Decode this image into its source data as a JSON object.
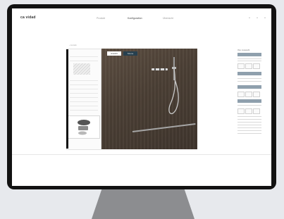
{
  "header": {
    "brand": "ca vidad",
    "tabs": [
      "Produkt",
      "Konfiguration",
      "Übersicht"
    ],
    "icons": [
      "search-icon",
      "user-icon",
      "cart-icon"
    ]
  },
  "breadcrumb": "‹ zurück",
  "canvas": {
    "buttons": [
      "Ansicht",
      "Szene"
    ]
  },
  "right_panel": {
    "title": "Ihre Auswahl"
  },
  "colors": {
    "monitor_bezel": "#121212",
    "stand": "#8c8d90",
    "wall": "#4b3f35",
    "accent_button": "#27404f",
    "panel_accent": "#8fa0ad"
  }
}
